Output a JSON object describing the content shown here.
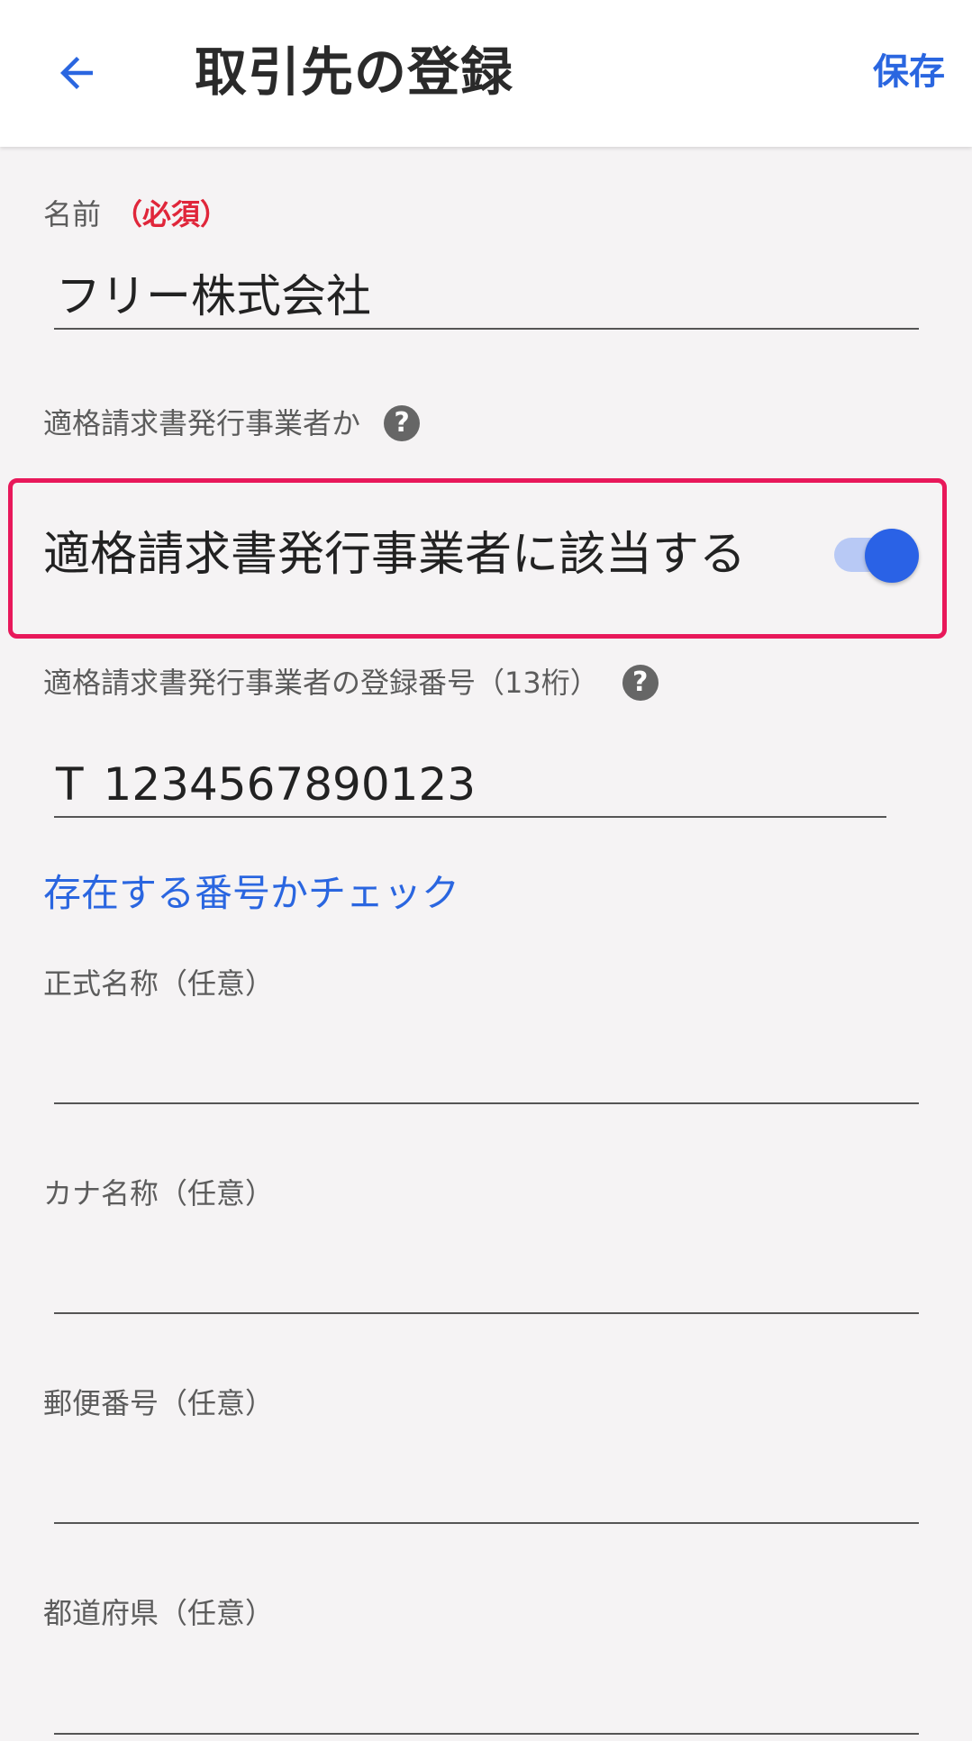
{
  "appbar": {
    "title": "取引先の登録",
    "save_label": "保存",
    "back_icon": "arrow-left-icon"
  },
  "form": {
    "name": {
      "label": "名前",
      "required": "（必須）",
      "value": "フリー株式会社"
    },
    "qualified": {
      "label": "適格請求書発行事業者か",
      "help_icon": "question-icon",
      "toggle_label": "適格請求書発行事業者に該当する",
      "toggle_on": true
    },
    "registration": {
      "label": "適格請求書発行事業者の登録番号（13桁）",
      "prefix": "T",
      "value": "1234567890123",
      "check_link": "存在する番号かチェック"
    },
    "formal_name": {
      "label": "正式名称（任意）",
      "value": ""
    },
    "kana_name": {
      "label": "カナ名称（任意）",
      "value": ""
    },
    "postal_code": {
      "label": "郵便番号（任意）",
      "value": ""
    },
    "prefecture": {
      "label": "都道府県（任意）",
      "value": ""
    }
  },
  "colors": {
    "accent": "#2a66e0",
    "required": "#e0263a",
    "highlight": "#e8185a",
    "toggle_thumb": "#2a62e6",
    "toggle_track": "#b8c9f5"
  }
}
